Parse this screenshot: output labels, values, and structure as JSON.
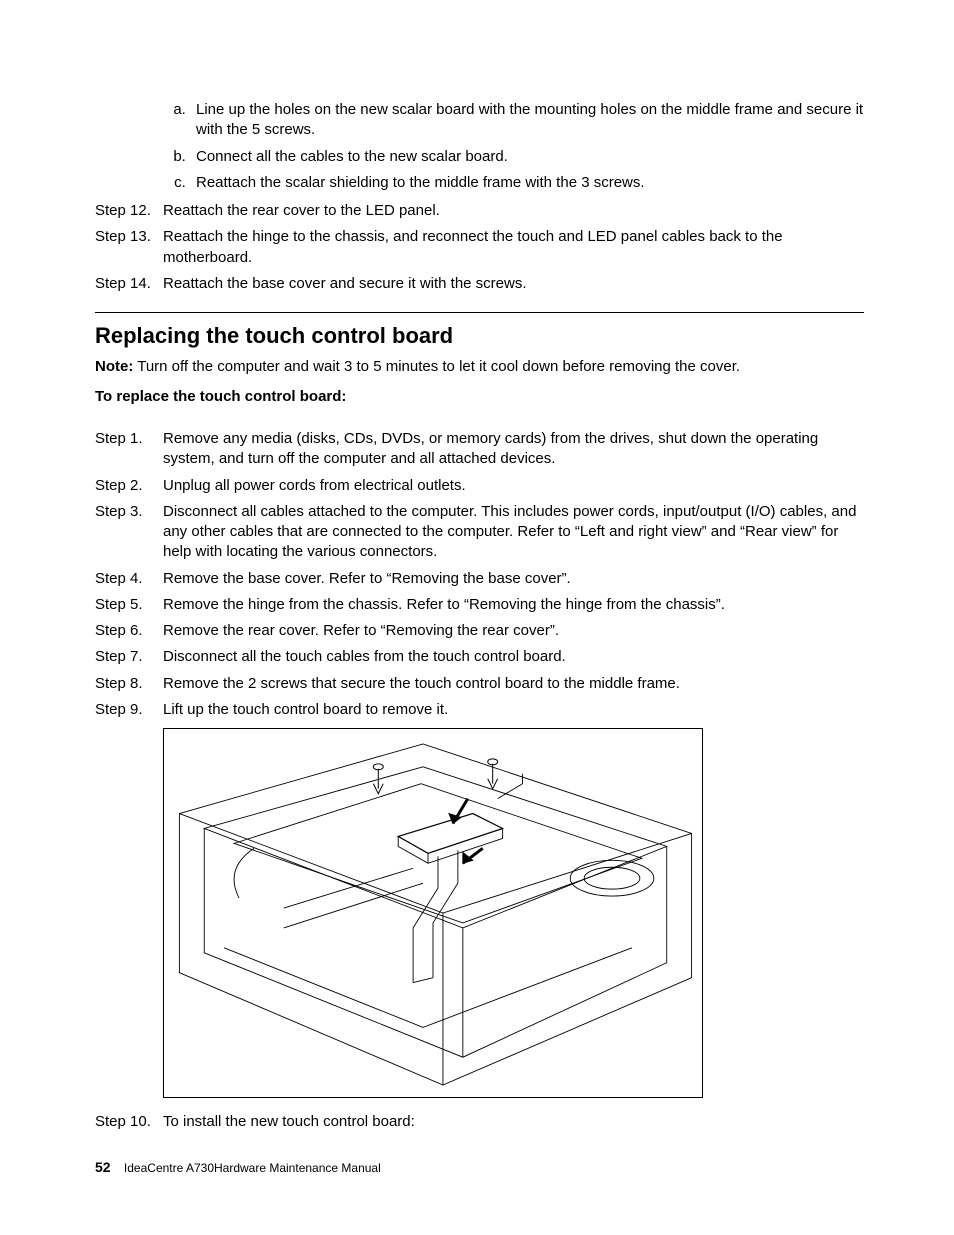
{
  "top": {
    "sub_a": "Line up the holes on the new scalar board with the mounting holes on the middle frame and secure it with the 5 screws.",
    "sub_b": "Connect all the cables to the new scalar board.",
    "sub_c": "Reattach the scalar shielding to the middle frame with the 3 screws.",
    "step12_label": "Step 12.",
    "step12": "Reattach the rear cover to the LED panel.",
    "step13_label": "Step 13.",
    "step13": "Reattach the hinge to the chassis, and reconnect the touch and LED panel cables back to the motherboard.",
    "step14_label": "Step 14.",
    "step14": "Reattach the base cover and secure it with the screws."
  },
  "section": {
    "title": "Replacing the touch control board",
    "note_label": "Note:",
    "note_text": " Turn off the computer and wait 3 to 5 minutes to let it cool down before removing the cover.",
    "subhead": "To replace the touch control board:",
    "step1_label": "Step 1.",
    "step1": "Remove any media (disks, CDs, DVDs, or memory cards) from the drives, shut down the operating system, and turn off the computer and all attached devices.",
    "step2_label": "Step 2.",
    "step2": "Unplug all power cords from electrical outlets.",
    "step3_label": "Step 3.",
    "step3": "Disconnect all cables attached to the computer. This includes power cords, input/output (I/O) cables, and any other cables that are connected to the computer. Refer to “Left and right view” and “Rear view” for help with locating the various connectors.",
    "step4_label": "Step 4.",
    "step4": "Remove the base cover. Refer to “Removing the base cover”.",
    "step5_label": "Step 5.",
    "step5": "Remove the hinge from the chassis. Refer to “Removing the hinge from the chassis”.",
    "step6_label": "Step 6.",
    "step6": "Remove the rear cover. Refer to “Removing the rear cover”.",
    "step7_label": "Step 7.",
    "step7": "Disconnect all the touch cables from the touch control board.",
    "step8_label": "Step 8.",
    "step8": "Remove the 2 screws that secure the touch control board to the middle frame.",
    "step9_label": "Step 9.",
    "step9": "Lift up the touch control board to remove it.",
    "step10_label": "Step 10.",
    "step10": "To install the new touch control board:"
  },
  "footer": {
    "page": "52",
    "doc": "IdeaCentre A730Hardware Maintenance Manual"
  }
}
